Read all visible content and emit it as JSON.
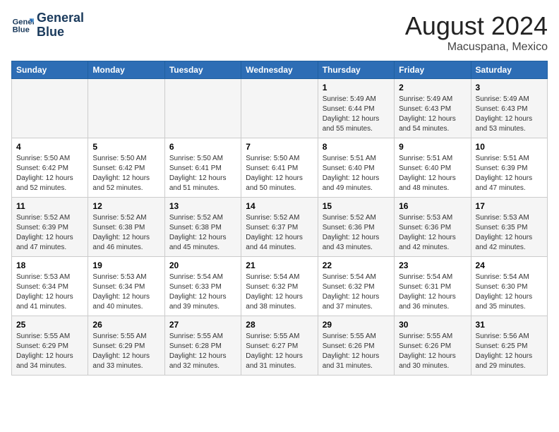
{
  "header": {
    "logo_line1": "General",
    "logo_line2": "Blue",
    "main_title": "August 2024",
    "subtitle": "Macuspana, Mexico"
  },
  "days_of_week": [
    "Sunday",
    "Monday",
    "Tuesday",
    "Wednesday",
    "Thursday",
    "Friday",
    "Saturday"
  ],
  "weeks": [
    [
      {
        "day": "",
        "info": ""
      },
      {
        "day": "",
        "info": ""
      },
      {
        "day": "",
        "info": ""
      },
      {
        "day": "",
        "info": ""
      },
      {
        "day": "1",
        "info": "Sunrise: 5:49 AM\nSunset: 6:44 PM\nDaylight: 12 hours\nand 55 minutes."
      },
      {
        "day": "2",
        "info": "Sunrise: 5:49 AM\nSunset: 6:43 PM\nDaylight: 12 hours\nand 54 minutes."
      },
      {
        "day": "3",
        "info": "Sunrise: 5:49 AM\nSunset: 6:43 PM\nDaylight: 12 hours\nand 53 minutes."
      }
    ],
    [
      {
        "day": "4",
        "info": "Sunrise: 5:50 AM\nSunset: 6:42 PM\nDaylight: 12 hours\nand 52 minutes."
      },
      {
        "day": "5",
        "info": "Sunrise: 5:50 AM\nSunset: 6:42 PM\nDaylight: 12 hours\nand 52 minutes."
      },
      {
        "day": "6",
        "info": "Sunrise: 5:50 AM\nSunset: 6:41 PM\nDaylight: 12 hours\nand 51 minutes."
      },
      {
        "day": "7",
        "info": "Sunrise: 5:50 AM\nSunset: 6:41 PM\nDaylight: 12 hours\nand 50 minutes."
      },
      {
        "day": "8",
        "info": "Sunrise: 5:51 AM\nSunset: 6:40 PM\nDaylight: 12 hours\nand 49 minutes."
      },
      {
        "day": "9",
        "info": "Sunrise: 5:51 AM\nSunset: 6:40 PM\nDaylight: 12 hours\nand 48 minutes."
      },
      {
        "day": "10",
        "info": "Sunrise: 5:51 AM\nSunset: 6:39 PM\nDaylight: 12 hours\nand 47 minutes."
      }
    ],
    [
      {
        "day": "11",
        "info": "Sunrise: 5:52 AM\nSunset: 6:39 PM\nDaylight: 12 hours\nand 47 minutes."
      },
      {
        "day": "12",
        "info": "Sunrise: 5:52 AM\nSunset: 6:38 PM\nDaylight: 12 hours\nand 46 minutes."
      },
      {
        "day": "13",
        "info": "Sunrise: 5:52 AM\nSunset: 6:38 PM\nDaylight: 12 hours\nand 45 minutes."
      },
      {
        "day": "14",
        "info": "Sunrise: 5:52 AM\nSunset: 6:37 PM\nDaylight: 12 hours\nand 44 minutes."
      },
      {
        "day": "15",
        "info": "Sunrise: 5:52 AM\nSunset: 6:36 PM\nDaylight: 12 hours\nand 43 minutes."
      },
      {
        "day": "16",
        "info": "Sunrise: 5:53 AM\nSunset: 6:36 PM\nDaylight: 12 hours\nand 42 minutes."
      },
      {
        "day": "17",
        "info": "Sunrise: 5:53 AM\nSunset: 6:35 PM\nDaylight: 12 hours\nand 42 minutes."
      }
    ],
    [
      {
        "day": "18",
        "info": "Sunrise: 5:53 AM\nSunset: 6:34 PM\nDaylight: 12 hours\nand 41 minutes."
      },
      {
        "day": "19",
        "info": "Sunrise: 5:53 AM\nSunset: 6:34 PM\nDaylight: 12 hours\nand 40 minutes."
      },
      {
        "day": "20",
        "info": "Sunrise: 5:54 AM\nSunset: 6:33 PM\nDaylight: 12 hours\nand 39 minutes."
      },
      {
        "day": "21",
        "info": "Sunrise: 5:54 AM\nSunset: 6:32 PM\nDaylight: 12 hours\nand 38 minutes."
      },
      {
        "day": "22",
        "info": "Sunrise: 5:54 AM\nSunset: 6:32 PM\nDaylight: 12 hours\nand 37 minutes."
      },
      {
        "day": "23",
        "info": "Sunrise: 5:54 AM\nSunset: 6:31 PM\nDaylight: 12 hours\nand 36 minutes."
      },
      {
        "day": "24",
        "info": "Sunrise: 5:54 AM\nSunset: 6:30 PM\nDaylight: 12 hours\nand 35 minutes."
      }
    ],
    [
      {
        "day": "25",
        "info": "Sunrise: 5:55 AM\nSunset: 6:29 PM\nDaylight: 12 hours\nand 34 minutes."
      },
      {
        "day": "26",
        "info": "Sunrise: 5:55 AM\nSunset: 6:29 PM\nDaylight: 12 hours\nand 33 minutes."
      },
      {
        "day": "27",
        "info": "Sunrise: 5:55 AM\nSunset: 6:28 PM\nDaylight: 12 hours\nand 32 minutes."
      },
      {
        "day": "28",
        "info": "Sunrise: 5:55 AM\nSunset: 6:27 PM\nDaylight: 12 hours\nand 31 minutes."
      },
      {
        "day": "29",
        "info": "Sunrise: 5:55 AM\nSunset: 6:26 PM\nDaylight: 12 hours\nand 31 minutes."
      },
      {
        "day": "30",
        "info": "Sunrise: 5:55 AM\nSunset: 6:26 PM\nDaylight: 12 hours\nand 30 minutes."
      },
      {
        "day": "31",
        "info": "Sunrise: 5:56 AM\nSunset: 6:25 PM\nDaylight: 12 hours\nand 29 minutes."
      }
    ]
  ]
}
